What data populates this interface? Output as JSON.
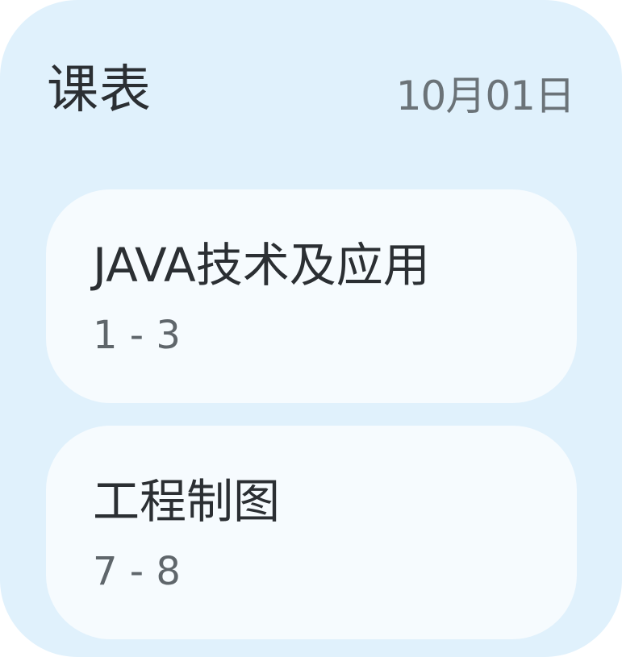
{
  "widget": {
    "title": "课表",
    "date": "10月01日"
  },
  "courses": [
    {
      "name": "JAVA技术及应用",
      "periods": "1 - 3"
    },
    {
      "name": "工程制图",
      "periods": "7 - 8"
    }
  ],
  "colors": {
    "widget_background": "#e0f1fc",
    "card_background": "#f6fbfe",
    "primary_text": "#2b2f33",
    "secondary_text": "#6b7378"
  }
}
